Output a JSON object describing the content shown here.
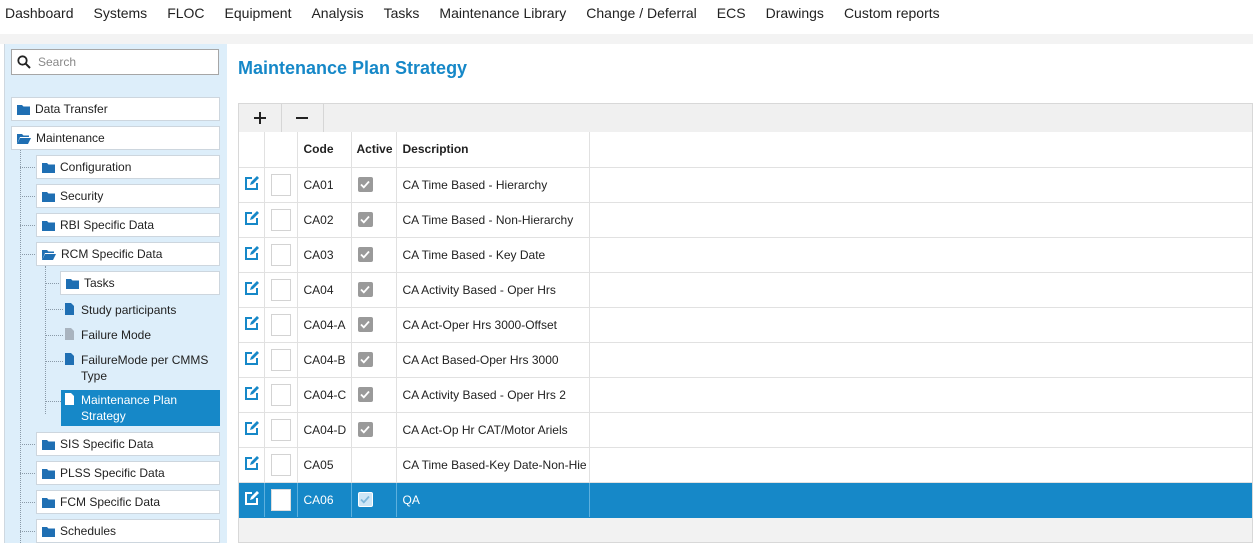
{
  "nav": [
    "Dashboard",
    "Systems",
    "FLOC",
    "Equipment",
    "Analysis",
    "Tasks",
    "Maintenance Library",
    "Change / Deferral",
    "ECS",
    "Drawings",
    "Custom reports"
  ],
  "search": {
    "placeholder": "Search"
  },
  "tree": {
    "data_transfer": "Data Transfer",
    "maintenance": "Maintenance",
    "configuration": "Configuration",
    "security": "Security",
    "rbi": "RBI Specific Data",
    "rcm": "RCM Specific Data",
    "tasks": "Tasks",
    "study_participants": "Study participants",
    "failure_mode": "Failure Mode",
    "failuremode_cmms_line1": "FailureMode per CMMS",
    "failuremode_cmms_line2": "Type",
    "mps_line1": "Maintenance Plan",
    "mps_line2": "Strategy",
    "sis": "SIS Specific Data",
    "plss": "PLSS Specific Data",
    "fcm": "FCM Specific Data",
    "schedules": "Schedules"
  },
  "page": {
    "title": "Maintenance Plan Strategy"
  },
  "toolbar": {
    "add_icon": "plus-icon",
    "remove_icon": "minus-icon"
  },
  "grid": {
    "headers": {
      "code": "Code",
      "active": "Active",
      "description": "Description"
    },
    "rows": [
      {
        "code": "CA01",
        "active": true,
        "description": "CA Time Based - Hierarchy"
      },
      {
        "code": "CA02",
        "active": true,
        "description": "CA Time Based - Non-Hierarchy"
      },
      {
        "code": "CA03",
        "active": true,
        "description": "CA Time Based - Key Date"
      },
      {
        "code": "CA04",
        "active": true,
        "description": "CA Activity Based - Oper Hrs"
      },
      {
        "code": "CA04-A",
        "active": true,
        "description": "CA Act-Oper Hrs 3000-Offset"
      },
      {
        "code": "CA04-B",
        "active": true,
        "description": "CA Act Based-Oper Hrs 3000"
      },
      {
        "code": "CA04-C",
        "active": true,
        "description": "CA Activity Based - Oper Hrs 2"
      },
      {
        "code": "CA04-D",
        "active": true,
        "description": "CA Act-Op Hr CAT/Motor Ariels"
      },
      {
        "code": "CA05",
        "active": false,
        "description": "CA Time Based-Key Date-Non-Hie"
      },
      {
        "code": "CA06",
        "active": true,
        "description": "QA"
      }
    ],
    "selected_row": "CA06"
  },
  "colors": {
    "accent": "#1688c8",
    "sidebar_bg": "#ddeefa"
  }
}
